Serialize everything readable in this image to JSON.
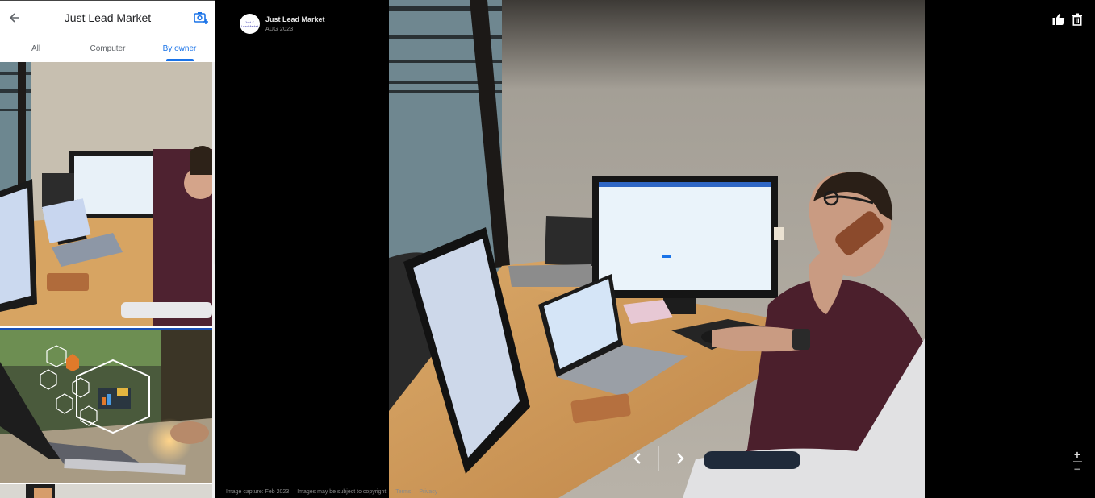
{
  "panel": {
    "title": "Just Lead Market",
    "back_icon": "arrow-left-icon",
    "add_photo_icon": "add-photo-camera-icon",
    "tabs": [
      {
        "label": "All",
        "active": false
      },
      {
        "label": "Computer",
        "active": false
      },
      {
        "label": "By owner",
        "active": true
      }
    ],
    "thumbnails": [
      {
        "alt": "Man on phone at desk with monitors and laptops",
        "selected": false
      },
      {
        "alt": "Laptop with digital marketing icons overlay",
        "selected": true
      },
      {
        "alt": "Office interior",
        "selected": false
      }
    ],
    "collapse_icon": "caret-left-icon"
  },
  "viewer": {
    "owner": {
      "name": "Just Lead Market",
      "date": "AUG 2023",
      "avatar_text_line1": "Just ✓",
      "avatar_text_line2": "LeadMarket"
    },
    "actions": {
      "like_icon": "thumbs-up-icon",
      "delete_icon": "trash-icon"
    },
    "nav": {
      "prev_icon": "chevron-left-icon",
      "next_icon": "chevron-right-icon"
    },
    "zoom": {
      "in_label": "+",
      "out_label": "−"
    },
    "footer": {
      "capture": "Image capture: Feb 2023",
      "copyright": "Images may be subject to copyright.",
      "terms": "Terms",
      "privacy": "Privacy"
    },
    "accent_color": "#1a73e8"
  }
}
